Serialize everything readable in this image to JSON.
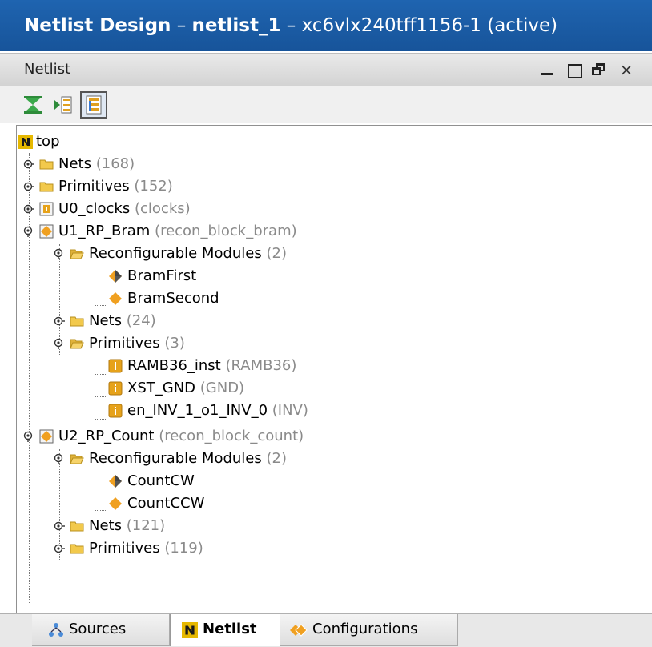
{
  "window": {
    "title_prefix": "Netlist Design",
    "title_sep1": " – ",
    "title_design": "netlist_1",
    "title_sep2": " – ",
    "title_part": "xc6vlx240tff1156-1 (active)"
  },
  "panel": {
    "title": "Netlist",
    "close_glyph": "×"
  },
  "toolbar": {
    "icons": [
      "collapse-all-icon",
      "scroll-to-selected-icon",
      "flat-view-icon"
    ]
  },
  "tree": {
    "root": "top",
    "nets": "Nets",
    "nets_count": "(168)",
    "prims": "Primitives",
    "prims_count": "(152)",
    "u0": "U0_clocks",
    "u0_type": "(clocks)",
    "u1": "U1_RP_Bram",
    "u1_type": "(recon_block_bram)",
    "u1_rm": "Reconfigurable Modules",
    "u1_rm_count": "(2)",
    "u1_rm_a": "BramFirst",
    "u1_rm_b": "BramSecond",
    "u1_nets": "Nets",
    "u1_nets_count": "(24)",
    "u1_prims": "Primitives",
    "u1_prims_count": "(3)",
    "u1_p1": "RAMB36_inst",
    "u1_p1_type": "(RAMB36)",
    "u1_p2": "XST_GND",
    "u1_p2_type": "(GND)",
    "u1_p3": "en_INV_1_o1_INV_0",
    "u1_p3_type": "(INV)",
    "u2": "U2_RP_Count",
    "u2_type": "(recon_block_count)",
    "u2_rm": "Reconfigurable Modules",
    "u2_rm_count": "(2)",
    "u2_rm_a": "CountCW",
    "u2_rm_b": "CountCCW",
    "u2_nets": "Nets",
    "u2_nets_count": "(121)",
    "u2_prims": "Primitives",
    "u2_prims_count": "(119)"
  },
  "tabs": {
    "sources": "Sources",
    "netlist": "Netlist",
    "configurations": "Configurations"
  },
  "colors": {
    "title_bar": "#1a5aa5",
    "folder": "#f2c94c",
    "module": "#f0a020",
    "instance": "#e6a21a"
  }
}
